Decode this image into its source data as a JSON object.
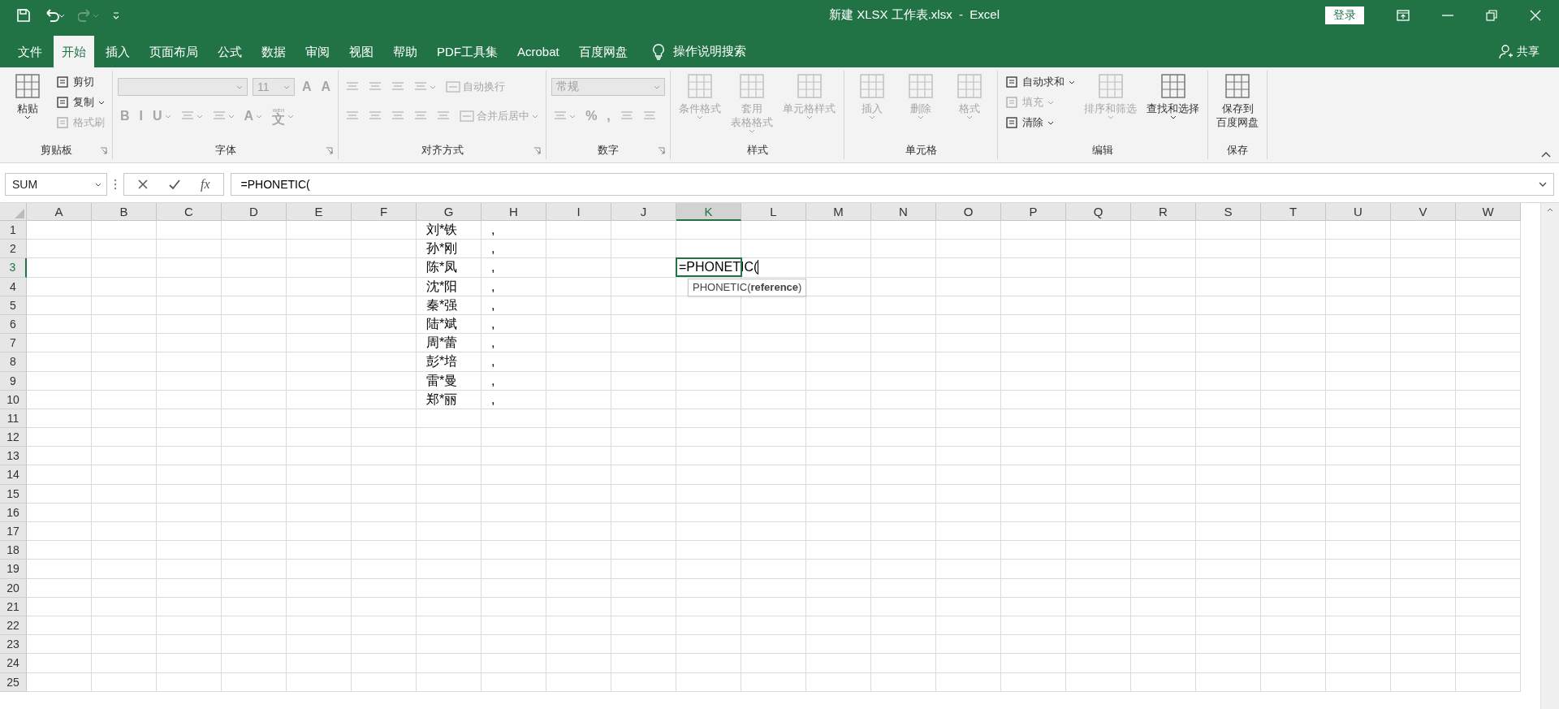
{
  "title_bar": {
    "title": "新建 XLSX 工作表.xlsx  -  Excel",
    "sign_in": "登录"
  },
  "tabs": [
    {
      "label": "文件",
      "selected": false
    },
    {
      "label": "开始",
      "selected": true
    },
    {
      "label": "插入",
      "selected": false
    },
    {
      "label": "页面布局",
      "selected": false
    },
    {
      "label": "公式",
      "selected": false
    },
    {
      "label": "数据",
      "selected": false
    },
    {
      "label": "审阅",
      "selected": false
    },
    {
      "label": "视图",
      "selected": false
    },
    {
      "label": "帮助",
      "selected": false
    },
    {
      "label": "PDF工具集",
      "selected": false
    },
    {
      "label": "Acrobat",
      "selected": false
    },
    {
      "label": "百度网盘",
      "selected": false
    }
  ],
  "tell_me": "操作说明搜索",
  "share": "共享",
  "ribbon": [
    {
      "label": "剪贴板",
      "launcher": true,
      "items": [
        {
          "kind": "large",
          "lines": [
            "粘贴"
          ],
          "disabled": false,
          "menu": true
        },
        {
          "kind": "stack",
          "items": [
            {
              "label": "剪切",
              "disabled": false,
              "menu": false
            },
            {
              "label": "复制",
              "disabled": false,
              "menu": true
            },
            {
              "label": "格式刷",
              "disabled": true,
              "menu": false
            }
          ]
        }
      ]
    },
    {
      "label": "字体",
      "launcher": true,
      "items": [
        {
          "kind": "toolrows",
          "rows": [
            [
              {
                "kind": "font-combo",
                "disabled": true
              },
              {
                "kind": "size-combo",
                "value": "11",
                "disabled": true
              },
              {
                "kind": "glyph",
                "text": "A",
                "disabled": true,
                "menu": false
              },
              {
                "kind": "glyph",
                "text": "A",
                "disabled": true,
                "menu": false
              }
            ],
            [
              {
                "kind": "glyph",
                "text": "B",
                "disabled": true,
                "menu": false
              },
              {
                "kind": "glyph",
                "text": "I",
                "disabled": true,
                "menu": false
              },
              {
                "kind": "glyph",
                "text": "U",
                "disabled": true,
                "menu": true
              },
              {
                "kind": "icon",
                "disabled": true,
                "menu": true
              },
              {
                "kind": "icon",
                "disabled": true,
                "menu": true
              },
              {
                "kind": "glyph",
                "text": "A",
                "disabled": true,
                "menu": true
              },
              {
                "kind": "glyph",
                "text": "文",
                "ruby": "wén",
                "disabled": true,
                "menu": true
              }
            ]
          ]
        }
      ]
    },
    {
      "label": "对齐方式",
      "launcher": true,
      "items": [
        {
          "kind": "toolrows",
          "rows": [
            [
              {
                "kind": "icon",
                "disabled": true,
                "menu": false
              },
              {
                "kind": "icon",
                "disabled": true,
                "menu": false
              },
              {
                "kind": "icon",
                "disabled": true,
                "menu": false
              },
              {
                "kind": "icon",
                "disabled": true,
                "menu": true
              },
              {
                "kind": "text-button",
                "label": "自动换行",
                "disabled": true,
                "menu": false
              }
            ],
            [
              {
                "kind": "icon",
                "disabled": true,
                "menu": false
              },
              {
                "kind": "icon",
                "disabled": true,
                "menu": false
              },
              {
                "kind": "icon",
                "disabled": true,
                "menu": false
              },
              {
                "kind": "icon",
                "disabled": true,
                "menu": false
              },
              {
                "kind": "icon",
                "disabled": true,
                "menu": false
              },
              {
                "kind": "text-button",
                "label": "合并后居中",
                "disabled": true,
                "menu": true
              }
            ]
          ]
        }
      ]
    },
    {
      "label": "数字",
      "launcher": true,
      "items": [
        {
          "kind": "toolrows",
          "rows": [
            [
              {
                "kind": "format-combo",
                "value": "常规",
                "disabled": true
              }
            ],
            [
              {
                "kind": "icon",
                "disabled": true,
                "menu": true
              },
              {
                "kind": "glyph",
                "text": "%",
                "disabled": true,
                "menu": false
              },
              {
                "kind": "glyph",
                "text": ",",
                "disabled": true,
                "menu": false
              },
              {
                "kind": "icon",
                "disabled": true,
                "menu": false
              },
              {
                "kind": "icon",
                "disabled": true,
                "menu": false
              }
            ]
          ]
        }
      ]
    },
    {
      "label": "样式",
      "launcher": false,
      "items": [
        {
          "kind": "large",
          "lines": [
            "条件格式"
          ],
          "disabled": true,
          "menu": true
        },
        {
          "kind": "large",
          "lines": [
            "套用",
            "表格格式"
          ],
          "disabled": true,
          "menu": true
        },
        {
          "kind": "large",
          "lines": [
            "单元格样式"
          ],
          "disabled": true,
          "menu": true
        }
      ]
    },
    {
      "label": "单元格",
      "launcher": false,
      "items": [
        {
          "kind": "large",
          "lines": [
            "插入"
          ],
          "disabled": true,
          "menu": true
        },
        {
          "kind": "large",
          "lines": [
            "删除"
          ],
          "disabled": true,
          "menu": true
        },
        {
          "kind": "large",
          "lines": [
            "格式"
          ],
          "disabled": true,
          "menu": true
        }
      ]
    },
    {
      "label": "编辑",
      "launcher": false,
      "items": [
        {
          "kind": "stack",
          "items": [
            {
              "label": "自动求和",
              "disabled": false,
              "menu": true
            },
            {
              "label": "填充",
              "disabled": true,
              "menu": true
            },
            {
              "label": "清除",
              "disabled": false,
              "menu": true
            }
          ]
        },
        {
          "kind": "large",
          "lines": [
            "排序和筛选"
          ],
          "disabled": true,
          "menu": true
        },
        {
          "kind": "large",
          "lines": [
            "查找和选择"
          ],
          "disabled": false,
          "menu": true
        }
      ]
    },
    {
      "label": "保存",
      "launcher": false,
      "items": [
        {
          "kind": "large",
          "lines": [
            "保存到",
            "百度网盘"
          ],
          "disabled": false,
          "menu": false
        }
      ]
    }
  ],
  "formula_bar": {
    "name_box": "SUM",
    "fx": "fx",
    "formula": "=PHONETIC("
  },
  "columns": [
    {
      "label": "A",
      "selected": false
    },
    {
      "label": "B",
      "selected": false
    },
    {
      "label": "C",
      "selected": false
    },
    {
      "label": "D",
      "selected": false
    },
    {
      "label": "E",
      "selected": false
    },
    {
      "label": "F",
      "selected": false
    },
    {
      "label": "G",
      "selected": false
    },
    {
      "label": "H",
      "selected": false
    },
    {
      "label": "I",
      "selected": false
    },
    {
      "label": "J",
      "selected": false
    },
    {
      "label": "K",
      "selected": true
    },
    {
      "label": "L",
      "selected": false
    },
    {
      "label": "M",
      "selected": false
    },
    {
      "label": "N",
      "selected": false
    },
    {
      "label": "O",
      "selected": false
    },
    {
      "label": "P",
      "selected": false
    },
    {
      "label": "Q",
      "selected": false
    },
    {
      "label": "R",
      "selected": false
    },
    {
      "label": "S",
      "selected": false
    },
    {
      "label": "T",
      "selected": false
    },
    {
      "label": "U",
      "selected": false
    },
    {
      "label": "V",
      "selected": false
    },
    {
      "label": "W",
      "selected": false
    }
  ],
  "rows": [
    {
      "label": "1",
      "selected": false,
      "cells": {
        "G": "刘*铁",
        "H": ","
      }
    },
    {
      "label": "2",
      "selected": false,
      "cells": {
        "G": "孙*刚",
        "H": ","
      }
    },
    {
      "label": "3",
      "selected": true,
      "cells": {
        "G": "陈*凤",
        "H": ","
      },
      "editing": {
        "K": "=PHONETIC("
      }
    },
    {
      "label": "4",
      "selected": false,
      "cells": {
        "G": "沈*阳",
        "H": ","
      }
    },
    {
      "label": "5",
      "selected": false,
      "cells": {
        "G": "秦*强",
        "H": ","
      }
    },
    {
      "label": "6",
      "selected": false,
      "cells": {
        "G": "陆*斌",
        "H": ","
      }
    },
    {
      "label": "7",
      "selected": false,
      "cells": {
        "G": "周*蕾",
        "H": ","
      }
    },
    {
      "label": "8",
      "selected": false,
      "cells": {
        "G": "彭*培",
        "H": ","
      }
    },
    {
      "label": "9",
      "selected": false,
      "cells": {
        "G": "雷*曼",
        "H": ","
      }
    },
    {
      "label": "10",
      "selected": false,
      "cells": {
        "G": "郑*丽",
        "H": ","
      }
    },
    {
      "label": "11",
      "selected": false
    },
    {
      "label": "12",
      "selected": false
    },
    {
      "label": "13",
      "selected": false
    },
    {
      "label": "14",
      "selected": false
    },
    {
      "label": "15",
      "selected": false
    },
    {
      "label": "16",
      "selected": false
    },
    {
      "label": "17",
      "selected": false
    },
    {
      "label": "18",
      "selected": false
    },
    {
      "label": "19",
      "selected": false
    },
    {
      "label": "20",
      "selected": false
    },
    {
      "label": "21",
      "selected": false
    },
    {
      "label": "22",
      "selected": false
    },
    {
      "label": "23",
      "selected": false
    },
    {
      "label": "24",
      "selected": false
    },
    {
      "label": "25",
      "selected": false
    }
  ],
  "tooltip": "PHONETIC(**reference**)"
}
